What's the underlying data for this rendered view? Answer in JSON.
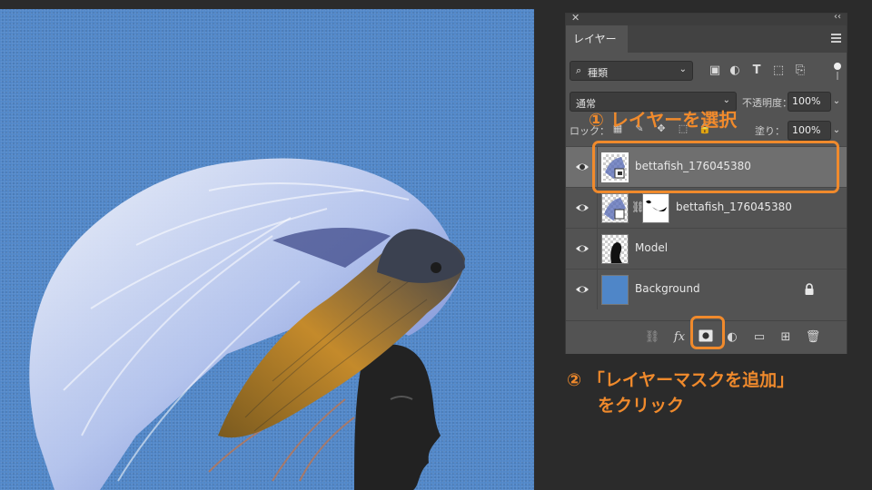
{
  "panel": {
    "title": "レイヤー",
    "filter_kind": "種類",
    "blend_mode": "通常",
    "opacity_label": "不透明度：",
    "opacity_value": "100%",
    "lock_label": "ロック：",
    "fill_label": "塗り：",
    "fill_value": "100%"
  },
  "icons": {
    "close": "close-icon",
    "collapse": "collapse-icon",
    "menu": "panel-menu-icon",
    "filter_icons": [
      "image-filter-icon",
      "adjustment-filter-icon",
      "type-filter-icon",
      "shape-filter-icon",
      "smart-object-filter-icon"
    ],
    "bottom": [
      "link-layers-icon",
      "fx-icon",
      "add-mask-icon",
      "adjustment-layer-icon",
      "folder-icon",
      "new-layer-icon",
      "trash-icon"
    ]
  },
  "layers": [
    {
      "name": "bettafish_176045380",
      "selected": true,
      "visible": true
    },
    {
      "name": "bettafish_176045380",
      "selected": false,
      "visible": true
    },
    {
      "name": "Model",
      "selected": false,
      "visible": true
    },
    {
      "name": "Background",
      "selected": false,
      "visible": true,
      "locked": true
    }
  ],
  "annotations": {
    "step1": "① レイヤーを選択",
    "step2_line1": "② 「レイヤーマスクを追加」",
    "step2_line2": "をクリック",
    "color": "#f08a2c"
  },
  "colors": {
    "canvas_bg": "#4f86c8",
    "panel_bg": "#535353",
    "selected_layer": "#6f6f6f"
  }
}
